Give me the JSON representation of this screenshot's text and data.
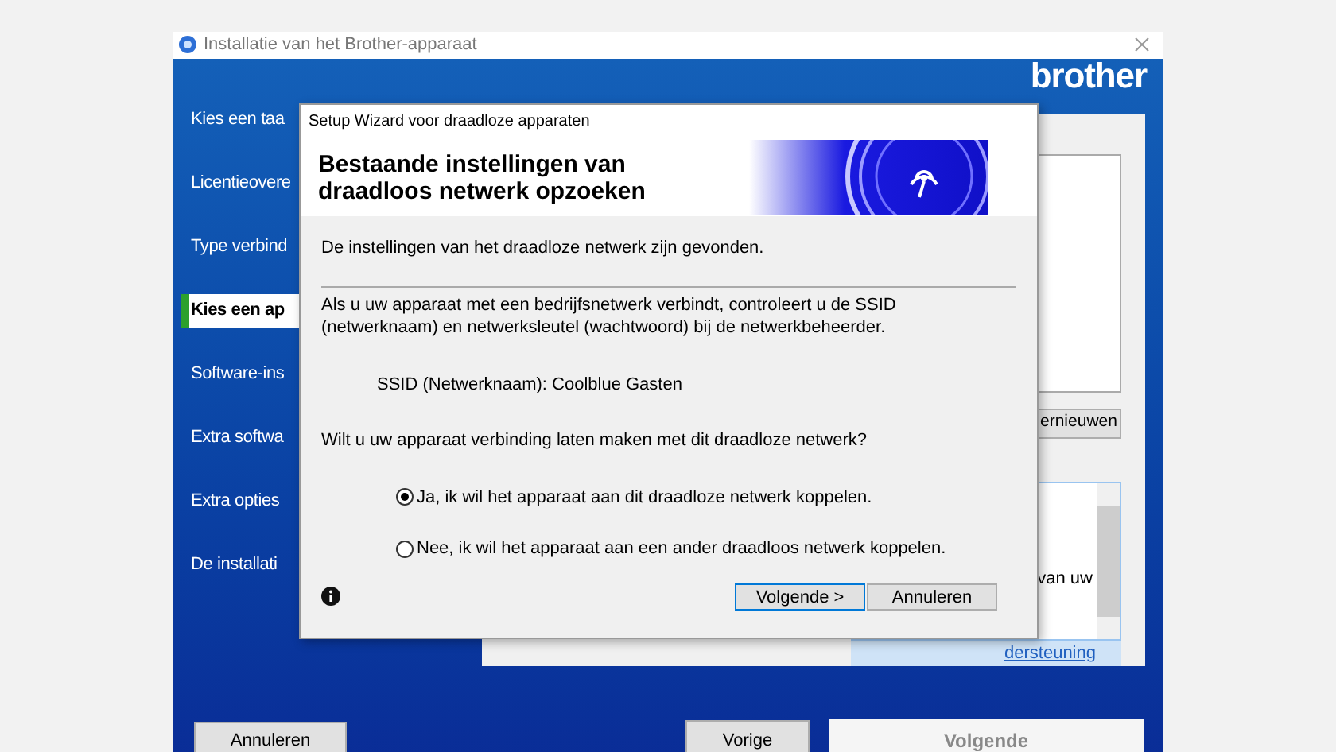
{
  "window": {
    "title": "Installatie van het Brother-apparaat",
    "logo": "brother"
  },
  "sidebar": {
    "items": [
      {
        "label": "Kies een taa",
        "selected": false
      },
      {
        "label": "Licentieovere",
        "selected": false
      },
      {
        "label": "Type verbind",
        "selected": false
      },
      {
        "label": "Kies een ap",
        "selected": true
      },
      {
        "label": "Software-ins",
        "selected": false
      },
      {
        "label": "Extra softwa",
        "selected": false
      },
      {
        "label": "Extra opties",
        "selected": false
      },
      {
        "label": "De installati",
        "selected": false
      }
    ]
  },
  "panel": {
    "refresh_button": "ernieuwen",
    "info_text": "van uw",
    "support_link": "dersteuning"
  },
  "footer": {
    "cancel": "Annuleren",
    "back": "Vorige",
    "next": {
      "label": "Volgende",
      "disabled": true
    }
  },
  "dialog": {
    "title": "Setup Wizard voor draadloze apparaten",
    "heading": "Bestaande instellingen van draadloos netwerk opzoeken",
    "found_text": "De instellingen van het draadloze netwerk zijn gevonden.",
    "note": "Als u uw apparaat met een bedrijfsnetwerk verbindt, controleert u de SSID (netwerknaam) en netwerksleutel (wachtwoord) bij de netwerkbeheerder.",
    "ssid": "SSID (Netwerknaam): Coolblue Gasten",
    "question": "Wilt u uw apparaat verbinding laten maken met dit draadloze netwerk?",
    "options": [
      {
        "label": "Ja, ik wil het apparaat aan dit draadloze netwerk koppelen.",
        "selected": true
      },
      {
        "label": "Nee, ik wil het apparaat aan een ander draadloos netwerk koppelen.",
        "selected": false
      }
    ],
    "buttons": [
      "Volgende >",
      "Annuleren"
    ]
  }
}
